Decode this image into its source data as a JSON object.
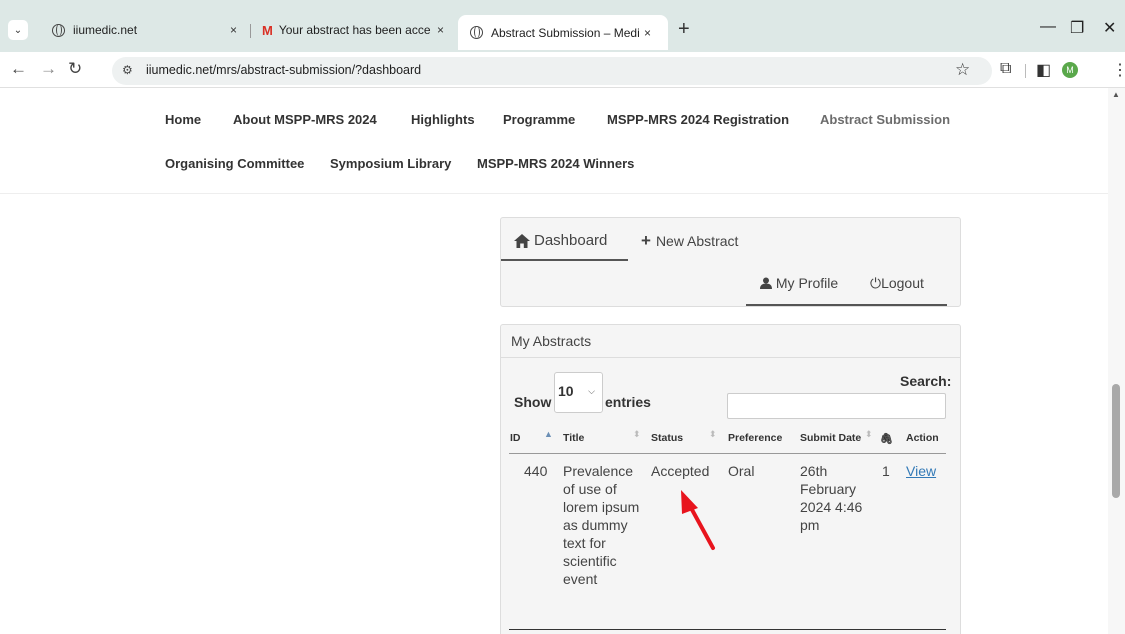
{
  "browser": {
    "tabs": [
      {
        "title": "iiumedic.net",
        "close": "×"
      },
      {
        "title": "Your abstract has been accepted",
        "close": "×"
      },
      {
        "title": "Abstract Submission – Medical Sc",
        "close": "×"
      }
    ],
    "new_tab": "+",
    "url": "iiumedic.net/mrs/abstract-submission/?dashboard"
  },
  "nav": {
    "row1": [
      "Home",
      "About MSPP-MRS 2024",
      "Highlights",
      "Programme",
      "MSPP-MRS 2024 Registration",
      "Abstract Submission"
    ],
    "row2": [
      "Organising Committee",
      "Symposium Library",
      "MSPP-MRS 2024 Winners"
    ]
  },
  "dashboard": {
    "tab_dashboard": "Dashboard",
    "tab_new": "New Abstract",
    "my_profile": "My Profile",
    "logout": "Logout"
  },
  "abstracts": {
    "heading": "My Abstracts",
    "show_label": "Show",
    "length_value": "10",
    "entries_label": "entries",
    "search_label": "Search:",
    "search_value": "",
    "columns": [
      "ID",
      "Title",
      "Status",
      "Preference",
      "Submit Date",
      "Action"
    ],
    "rows": [
      {
        "id": "440",
        "title": "Prevalence of use of lorem ipsum as dummy text for scientific event",
        "status": "Accepted",
        "preference": "Oral",
        "submit_date": "26th February 2024 4:46 pm",
        "attachments": "1",
        "action": "View"
      }
    ]
  },
  "colors": {
    "chrome_bg": "#dde8e6",
    "link": "#337ab7",
    "annotation_arrow": "#e8141d"
  }
}
